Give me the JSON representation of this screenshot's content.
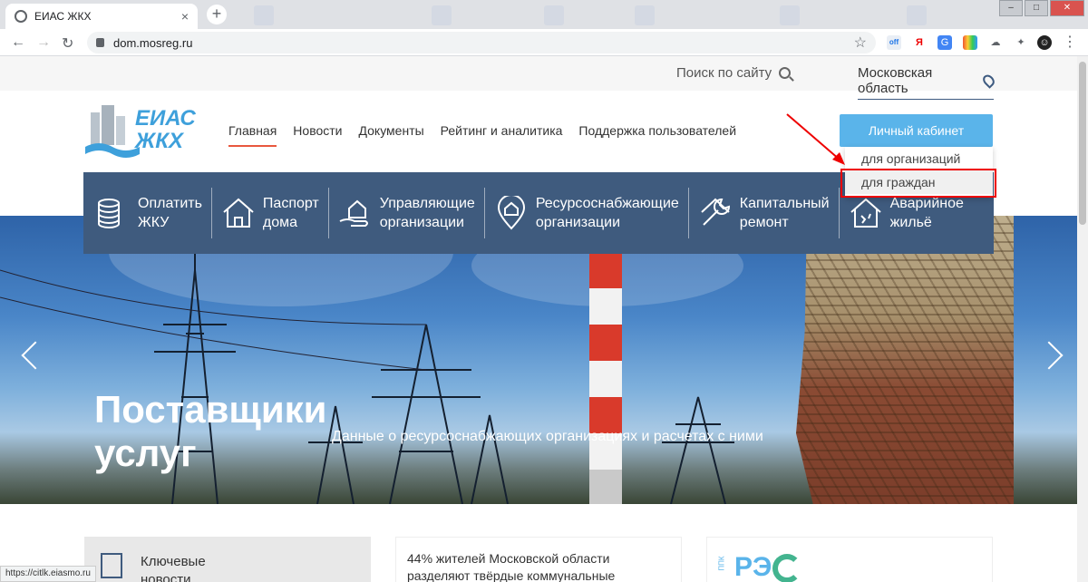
{
  "browser": {
    "tab_title": "ЕИАС ЖКХ",
    "tab_close": "×",
    "new_tab": "+",
    "url": "dom.mosreg.ru",
    "status_url": "https://citlk.eiasmo.ru",
    "ext_ya": "Я",
    "ext_off": "off",
    "ext_menu": "⋮"
  },
  "header": {
    "search_label": "Поиск по сайту",
    "region": "Московская область",
    "logo_line1": "ЕИАС",
    "logo_line2": "ЖКХ"
  },
  "nav": {
    "items": [
      "Главная",
      "Новости",
      "Документы",
      "Рейтинг и аналитика",
      "Поддержка пользователей"
    ],
    "active_index": 0
  },
  "account": {
    "button_label": "Личный кабинет",
    "dropdown": [
      "для организаций",
      "для граждан"
    ],
    "highlighted_index": 1
  },
  "services": [
    {
      "line1": "Оплатить",
      "line2": "ЖКУ",
      "icon": "coins-stack-icon"
    },
    {
      "line1": "Паспорт",
      "line2": "дома",
      "icon": "house-icon"
    },
    {
      "line1": "Управляющие",
      "line2": "организации",
      "icon": "hand-house-icon"
    },
    {
      "line1": "Ресурсоснабжающие",
      "line2": "организации",
      "icon": "location-pin-house-icon"
    },
    {
      "line1": "Капитальный",
      "line2": "ремонт",
      "icon": "wrench-gear-icon"
    },
    {
      "line1": "Аварийное",
      "line2": "жильё",
      "icon": "damaged-house-icon"
    }
  ],
  "hero": {
    "title_line1": "Поставщики",
    "title_line2": "услуг",
    "subtitle": "Данные о ресурсоснабжающих организациях и расчетах с ними"
  },
  "cards": {
    "key_news_line1": "Ключевые",
    "key_news_line2": "новости",
    "news_line1": "44% жителей Московской области",
    "news_line2": "разделяют твёрдые коммунальные",
    "reo_small": "ППК",
    "reo_text": "РЭ"
  },
  "colors": {
    "accent_blue": "#5ab4ea",
    "services_bg": "#3f5b7e",
    "active_underline": "#e8583e",
    "annotation_red": "#e00000"
  }
}
